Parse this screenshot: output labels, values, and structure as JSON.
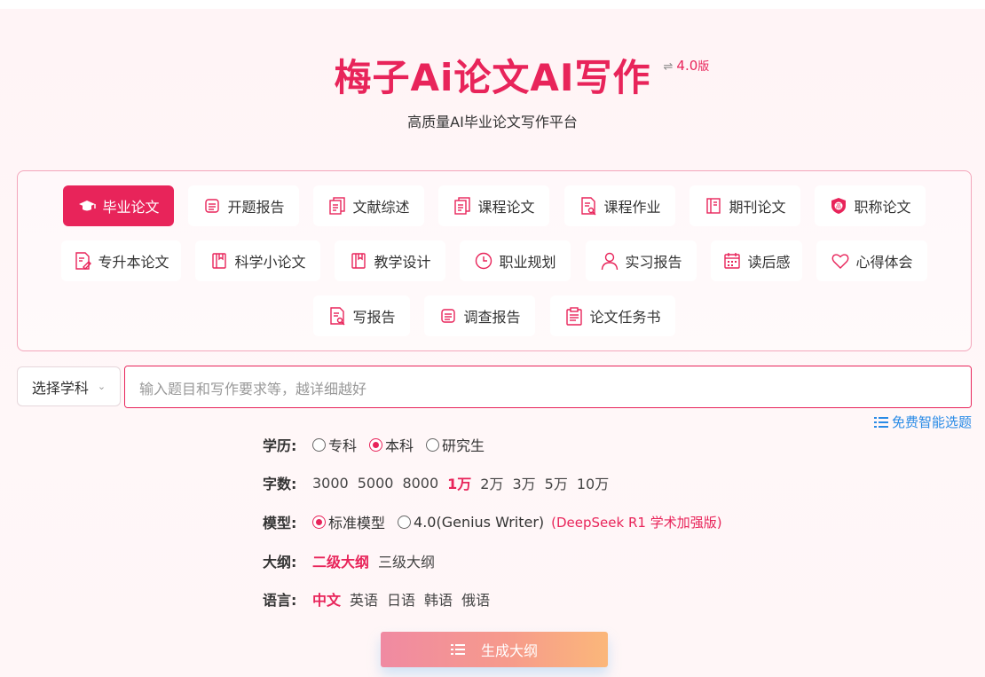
{
  "header": {
    "title": "梅子Ai论文AI写作",
    "version_icon": "⇌",
    "version": "4.0",
    "version_suffix": "版",
    "subtitle": "高质量AI毕业论文写作平台"
  },
  "paper_types": [
    {
      "label": "毕业论文",
      "icon": "graduation-cap-icon",
      "active": true
    },
    {
      "label": "开题报告",
      "icon": "report-icon"
    },
    {
      "label": "文献综述",
      "icon": "documents-icon"
    },
    {
      "label": "课程论文",
      "icon": "documents-icon"
    },
    {
      "label": "课程作业",
      "icon": "doc-search-icon"
    },
    {
      "label": "期刊论文",
      "icon": "journal-icon"
    },
    {
      "label": "职称论文",
      "icon": "badge-icon"
    },
    {
      "label": "专升本论文",
      "icon": "doc-edit-icon"
    },
    {
      "label": "科学小论文",
      "icon": "book-icon"
    },
    {
      "label": "教学设计",
      "icon": "book-icon"
    },
    {
      "label": "职业规划",
      "icon": "clock-icon"
    },
    {
      "label": "实习报告",
      "icon": "user-icon"
    },
    {
      "label": "读后感",
      "icon": "calendar-icon"
    },
    {
      "label": "心得体会",
      "icon": "heart-icon"
    },
    {
      "label": "写报告",
      "icon": "doc-search-icon"
    },
    {
      "label": "调查报告",
      "icon": "report-icon"
    },
    {
      "label": "论文任务书",
      "icon": "clipboard-icon"
    }
  ],
  "subject_select": {
    "label": "选择学科",
    "chevron": "⌄"
  },
  "topic_input": {
    "placeholder": "输入题目和写作要求等，越详细越好",
    "value": ""
  },
  "free_topic": {
    "icon": "list-icon",
    "label": "免费智能选题"
  },
  "options": {
    "education": {
      "label": "学历:",
      "choices": [
        "专科",
        "本科",
        "研究生"
      ],
      "selected": "本科"
    },
    "word_count": {
      "label": "字数:",
      "choices": [
        "3000",
        "5000",
        "8000",
        "1万",
        "2万",
        "3万",
        "5万",
        "10万"
      ],
      "selected": "1万"
    },
    "model": {
      "label": "模型:",
      "choices": [
        "标准模型",
        "4.0(Genius Writer)"
      ],
      "selected": "标准模型",
      "note": "(DeepSeek R1 学术加强版)"
    },
    "outline": {
      "label": "大纲:",
      "choices": [
        "二级大纲",
        "三级大纲"
      ],
      "selected": "二级大纲"
    },
    "language": {
      "label": "语言:",
      "choices": [
        "中文",
        "英语",
        "日语",
        "韩语",
        "俄语"
      ],
      "selected": "中文"
    }
  },
  "generate_button": {
    "label": "生成大纲",
    "icon": "list-icon"
  },
  "colors": {
    "accent": "#e8245a",
    "link": "#2a8be6",
    "icon": "#e8245a"
  }
}
